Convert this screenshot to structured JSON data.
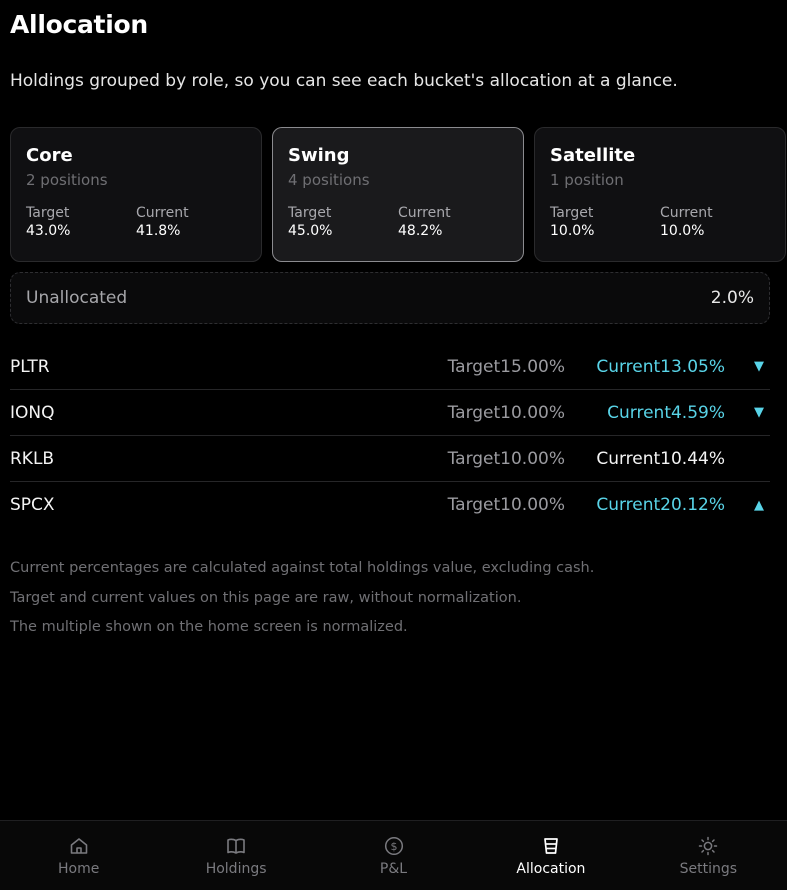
{
  "header": {
    "title": "Allocation",
    "subtitle": "Holdings grouped by role, so you can see each bucket's allocation at a glance."
  },
  "buckets": [
    {
      "name": "Core",
      "positions": "2 positions",
      "target_label": "Target",
      "target": "43.0%",
      "current_label": "Current",
      "current": "41.8%",
      "active": false
    },
    {
      "name": "Swing",
      "positions": "4 positions",
      "target_label": "Target",
      "target": "45.0%",
      "current_label": "Current",
      "current": "48.2%",
      "active": true
    },
    {
      "name": "Satellite",
      "positions": "1 position",
      "target_label": "Target",
      "target": "10.0%",
      "current_label": "Current",
      "current": "10.0%",
      "active": false
    }
  ],
  "unallocated": {
    "label": "Unallocated",
    "value": "2.0%"
  },
  "holdings": [
    {
      "ticker": "PLTR",
      "target": "Target15.00%",
      "current": "Current13.05%",
      "direction": "down",
      "arrow": "▼"
    },
    {
      "ticker": "IONQ",
      "target": "Target10.00%",
      "current": "Current4.59%",
      "direction": "down",
      "arrow": "▼"
    },
    {
      "ticker": "RKLB",
      "target": "Target10.00%",
      "current": "Current10.44%",
      "direction": "none",
      "arrow": ""
    },
    {
      "ticker": "SPCX",
      "target": "Target10.00%",
      "current": "Current20.12%",
      "direction": "up",
      "arrow": "▲"
    }
  ],
  "notes": [
    "Current percentages are calculated against total holdings value, excluding cash.",
    "Target and current values on this page are raw, without normalization.",
    "The multiple shown on the home screen is normalized."
  ],
  "nav": [
    {
      "label": "Home",
      "icon": "home-icon",
      "active": false
    },
    {
      "label": "Holdings",
      "icon": "book-icon",
      "active": false
    },
    {
      "label": "P&L",
      "icon": "dollar-icon",
      "active": false
    },
    {
      "label": "Allocation",
      "icon": "cup-icon",
      "active": true
    },
    {
      "label": "Settings",
      "icon": "sun-icon",
      "active": false
    }
  ],
  "colors": {
    "accent": "#59d4e8",
    "background": "#000000",
    "card": "#101012",
    "muted": "#707074"
  }
}
